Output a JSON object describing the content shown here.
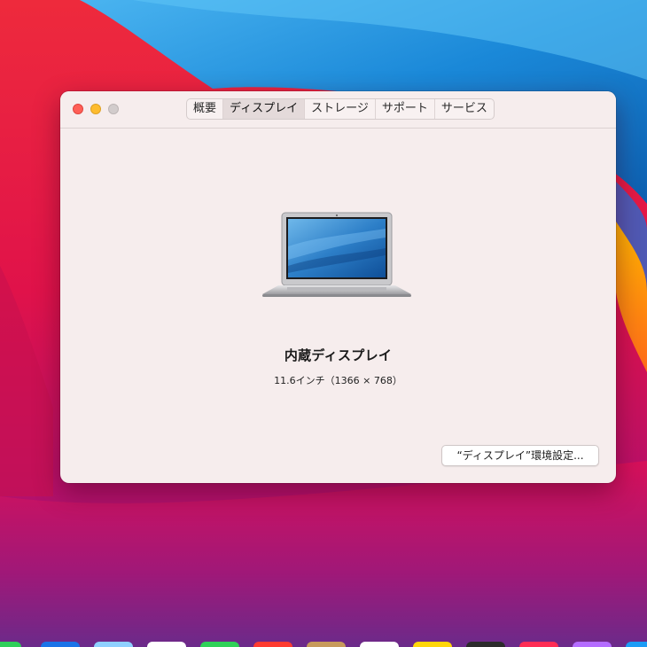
{
  "window": {
    "tabs": [
      {
        "label": "概要",
        "selected": false
      },
      {
        "label": "ディスプレイ",
        "selected": true
      },
      {
        "label": "ストレージ",
        "selected": false
      },
      {
        "label": "サポート",
        "selected": false
      },
      {
        "label": "サービス",
        "selected": false
      }
    ],
    "display": {
      "name": "内蔵ディスプレイ",
      "spec": "11.6インチ（1366 × 768）",
      "icon": "macbook-air-icon"
    },
    "prefs_button_label": "“ディスプレイ”環境設定..."
  },
  "colors": {
    "close": "#ff5f57",
    "minimize": "#febc2e",
    "zoom_disabled": "#d2cccc",
    "window_bg": "#f6eded"
  },
  "dock": {
    "item_colors": [
      "#2fcf5a",
      "#1a73e8",
      "#8fd0ff",
      "#ffffff",
      "#2fd158",
      "#ff3b30",
      "#c79a5b",
      "#ffffff",
      "#ffd60a",
      "#2b2b2b",
      "#ff2d55",
      "#b46cff",
      "#1c9cf6"
    ]
  }
}
